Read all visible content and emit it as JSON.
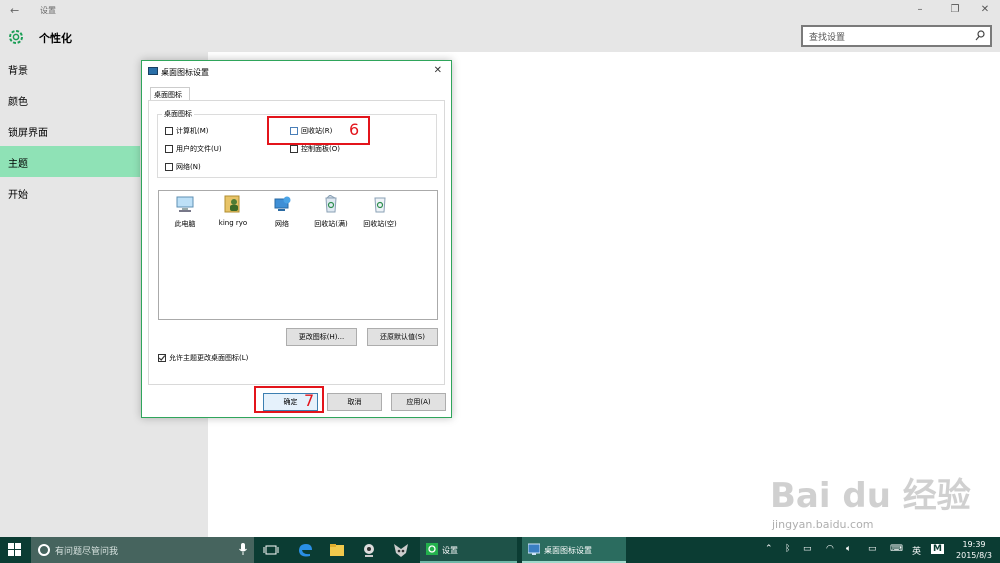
{
  "window": {
    "title": "设置",
    "back_glyph": "←"
  },
  "header": {
    "title": "个性化"
  },
  "search": {
    "placeholder": "查找设置"
  },
  "sidebar": {
    "items": [
      {
        "label": "背景"
      },
      {
        "label": "颜色"
      },
      {
        "label": "锁屏界面"
      },
      {
        "label": "主题",
        "active": true
      },
      {
        "label": "开始"
      }
    ]
  },
  "dialog": {
    "title": "桌面图标设置",
    "tab": "桌面图标",
    "group_label": "桌面图标",
    "checkboxes": [
      {
        "label": "计算机(M)",
        "checked": false
      },
      {
        "label": "回收站(R)",
        "checked": false
      },
      {
        "label": "用户的文件(U)",
        "checked": false
      },
      {
        "label": "控制面板(O)",
        "checked": false
      },
      {
        "label": "网络(N)",
        "checked": false
      }
    ],
    "icons": [
      {
        "label": "此电脑",
        "icon": "computer-icon"
      },
      {
        "label": "king ryo",
        "icon": "user-folder-icon"
      },
      {
        "label": "网络",
        "icon": "network-icon"
      },
      {
        "label": "回收站(满)",
        "icon": "recycle-bin-full-icon"
      },
      {
        "label": "回收站(空)",
        "icon": "recycle-bin-empty-icon"
      }
    ],
    "change_icon_label": "更改图标(H)...",
    "restore_default_label": "还原默认值(S)",
    "allow_themes_label": "允许主题更改桌面图标(L)",
    "allow_themes_checked": true,
    "ok_label": "确定",
    "cancel_label": "取消",
    "apply_label": "应用(A)"
  },
  "annotations": {
    "step6": "6",
    "step7": "7",
    "color": "#e3141b"
  },
  "watermark": {
    "logo": "Bai du 经验",
    "url": "jingyan.baidu.com"
  },
  "taskbar": {
    "search_placeholder": "有问题尽管问我",
    "tasks": [
      {
        "label": "设置"
      },
      {
        "label": "桌面图标设置"
      }
    ],
    "ime_label": "英",
    "ime_mode": "M",
    "time": "19:39",
    "date": "2015/8/3"
  },
  "colors": {
    "accent": "#8fe2b6",
    "taskbar": "#0b3c33",
    "sidebar": "#e6e6e6"
  }
}
